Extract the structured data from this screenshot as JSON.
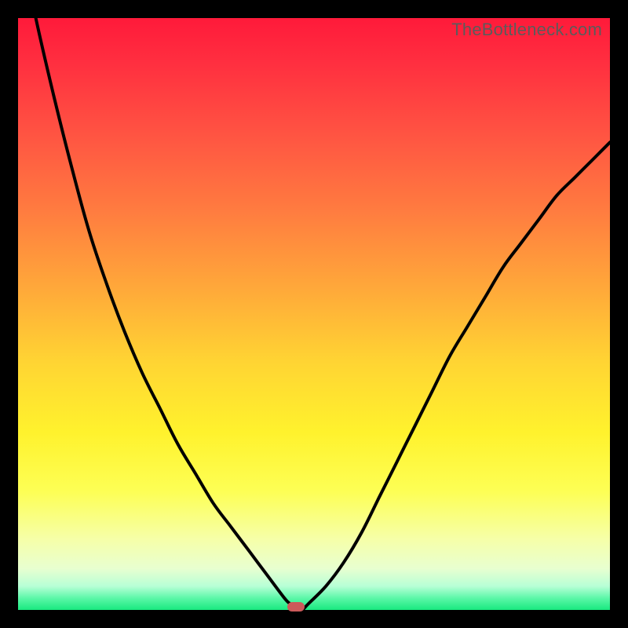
{
  "watermark": {
    "text": "TheBottleneck.com"
  },
  "colors": {
    "frame_border": "#000000",
    "curve": "#000000",
    "min_marker": "#cc5a5a",
    "gradient_top": "#ff1a3a",
    "gradient_bottom": "#19e97f"
  },
  "chart_data": {
    "type": "line",
    "title": "",
    "xlabel": "",
    "ylabel": "",
    "xlim": [
      0,
      100
    ],
    "ylim": [
      0,
      100
    ],
    "x": [
      0,
      3,
      6,
      9,
      12,
      15,
      18,
      21,
      24,
      27,
      30,
      33,
      36,
      39,
      42,
      45,
      46,
      47,
      48,
      49,
      52,
      55,
      58,
      61,
      64,
      67,
      70,
      73,
      76,
      79,
      82,
      85,
      88,
      91,
      94,
      97,
      100
    ],
    "values": [
      115,
      100,
      87,
      75,
      64,
      55,
      47,
      40,
      34,
      28,
      23,
      18,
      14,
      10,
      6,
      2,
      1,
      0,
      0,
      1,
      4,
      8,
      13,
      19,
      25,
      31,
      37,
      43,
      48,
      53,
      58,
      62,
      66,
      70,
      73,
      76,
      79
    ],
    "min_point": {
      "x": 47,
      "y": 0
    },
    "grid": false,
    "legend": false,
    "annotations": []
  }
}
